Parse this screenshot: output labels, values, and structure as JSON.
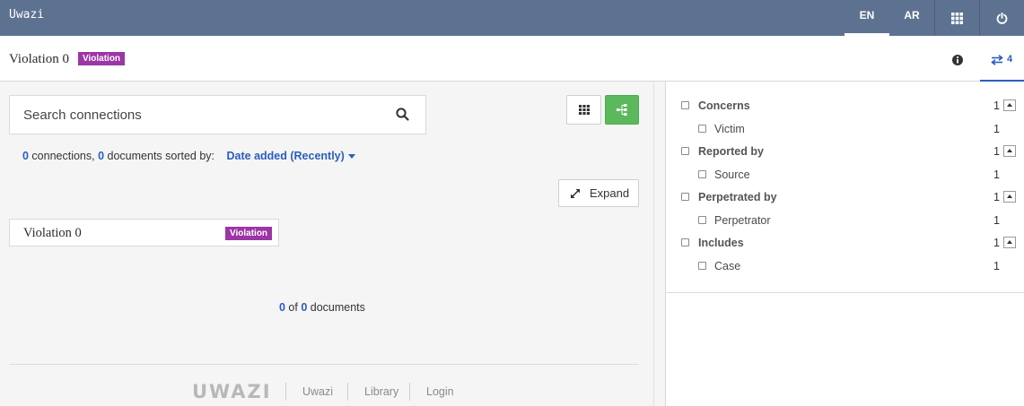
{
  "topbar": {
    "brand": "Uwazi",
    "languages": [
      "EN",
      "AR"
    ],
    "active_language": "EN"
  },
  "header": {
    "title": "Violation 0",
    "badge": "Violation",
    "connections_tab_count": "4"
  },
  "search": {
    "placeholder": "Search connections"
  },
  "summary": {
    "connections_count": "0",
    "connections_label": " connections, ",
    "documents_count": "0",
    "documents_label": " documents sorted by:",
    "sort_label": "Date added (Recently)"
  },
  "toolbar": {
    "expand_label": "Expand"
  },
  "card": {
    "title": "Violation 0",
    "badge": "Violation"
  },
  "pagination": {
    "shown": "0",
    "of_label": " of ",
    "total": "0",
    "documents_label": " documents"
  },
  "footer": {
    "logo": "UWAZI",
    "links": [
      "Uwazi",
      "Library",
      "Login"
    ]
  },
  "filters": {
    "groups": [
      {
        "label": "Concerns",
        "count": "1",
        "item": {
          "label": "Victim",
          "count": "1"
        }
      },
      {
        "label": "Reported by",
        "count": "1",
        "item": {
          "label": "Source",
          "count": "1"
        }
      },
      {
        "label": "Perpetrated by",
        "count": "1",
        "item": {
          "label": "Perpetrator",
          "count": "1"
        }
      },
      {
        "label": "Includes",
        "count": "1",
        "item": {
          "label": "Case",
          "count": "1"
        }
      }
    ]
  },
  "colors": {
    "topbar": "#5d7290",
    "accent": "#2b5dbe",
    "badge": "#9c35a6",
    "success": "#5cb85c"
  }
}
